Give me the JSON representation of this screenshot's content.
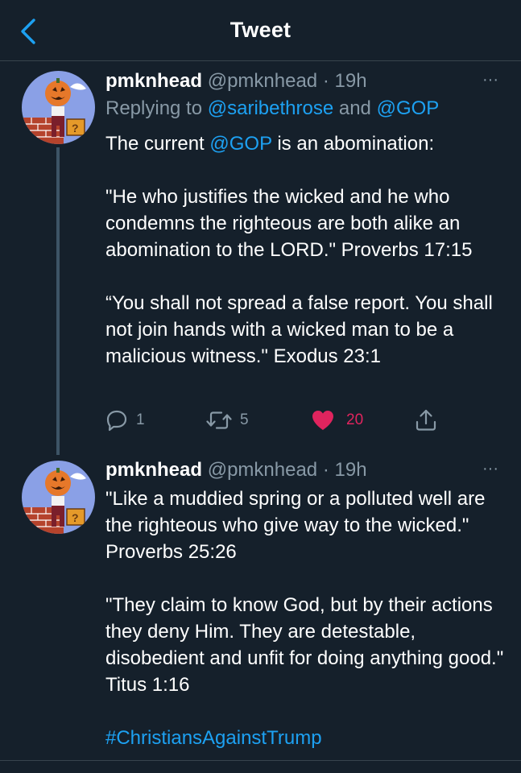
{
  "header": {
    "title": "Tweet",
    "back_icon": "chevron-left-icon"
  },
  "colors": {
    "background": "#15202b",
    "link": "#1da1f2",
    "muted": "#8899a6",
    "like": "#e0245e",
    "divider": "#38444d"
  },
  "tweets": [
    {
      "name": "pmknhead",
      "handle": "@pmknhead",
      "dot": "·",
      "time": "19h",
      "more": "···",
      "replying_prefix": "Replying to ",
      "replying_user1": "@saribethrose",
      "replying_and": " and ",
      "replying_user2": "@GOP",
      "line1_a": "The current ",
      "line1_link": "@GOP",
      "line1_b": " is an abomination:",
      "para2": "\"He who justifies the wicked and he who condemns the righteous are both alike an abomination to the LORD.\" Proverbs 17:15",
      "para3": "“You shall not spread a false report. You shall not join hands with a wicked man to be a malicious witness.\" Exodus 23:1",
      "reply_count": "1",
      "retweet_count": "5",
      "like_count": "20"
    },
    {
      "name": "pmknhead",
      "handle": "@pmknhead",
      "dot": "·",
      "time": "19h",
      "more": "···",
      "para1": "\"Like a muddied spring or a polluted well are the righteous who give way to the wicked.\" Proverbs 25:26",
      "para2": "\"They claim to know God, but by their actions they deny Him. They are detestable, disobedient and unfit for doing anything good.\" Titus 1:16",
      "hashtag": "#ChristiansAgainstTrump"
    }
  ]
}
